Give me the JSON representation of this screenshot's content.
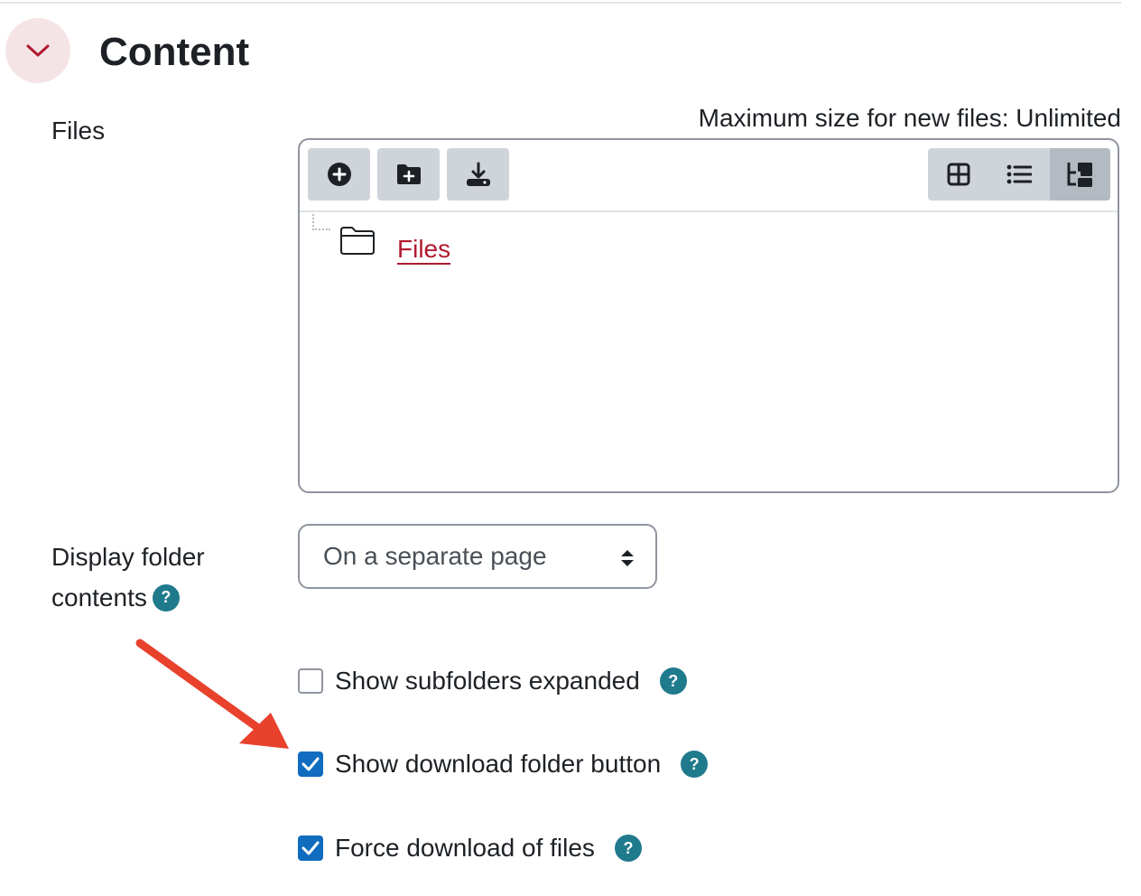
{
  "section": {
    "title": "Content",
    "collapse_icon": "chevron-down-icon",
    "accent": "#b01a30"
  },
  "files_field": {
    "label": "Files",
    "max_size_text": "Maximum size for new files: Unlimited",
    "toolbar": {
      "add_icon": "plus-circle-icon",
      "create_folder_icon": "folder-plus-icon",
      "download_icon": "download-icon",
      "view_icons": [
        "grid-icon",
        "list-icon",
        "tree-icon"
      ],
      "active_view": "tree"
    },
    "tree": {
      "root_folder": "Files"
    }
  },
  "display_field": {
    "label": "Display folder contents",
    "selected": "On a separate page"
  },
  "checkboxes": [
    {
      "label": "Show subfolders expanded",
      "checked": false
    },
    {
      "label": "Show download folder button",
      "checked": true
    },
    {
      "label": "Force download of files",
      "checked": true
    }
  ],
  "colors": {
    "checkbox": "#0f6cbf",
    "help": "#1f7a8c",
    "annotation_arrow": "#e8412c"
  }
}
